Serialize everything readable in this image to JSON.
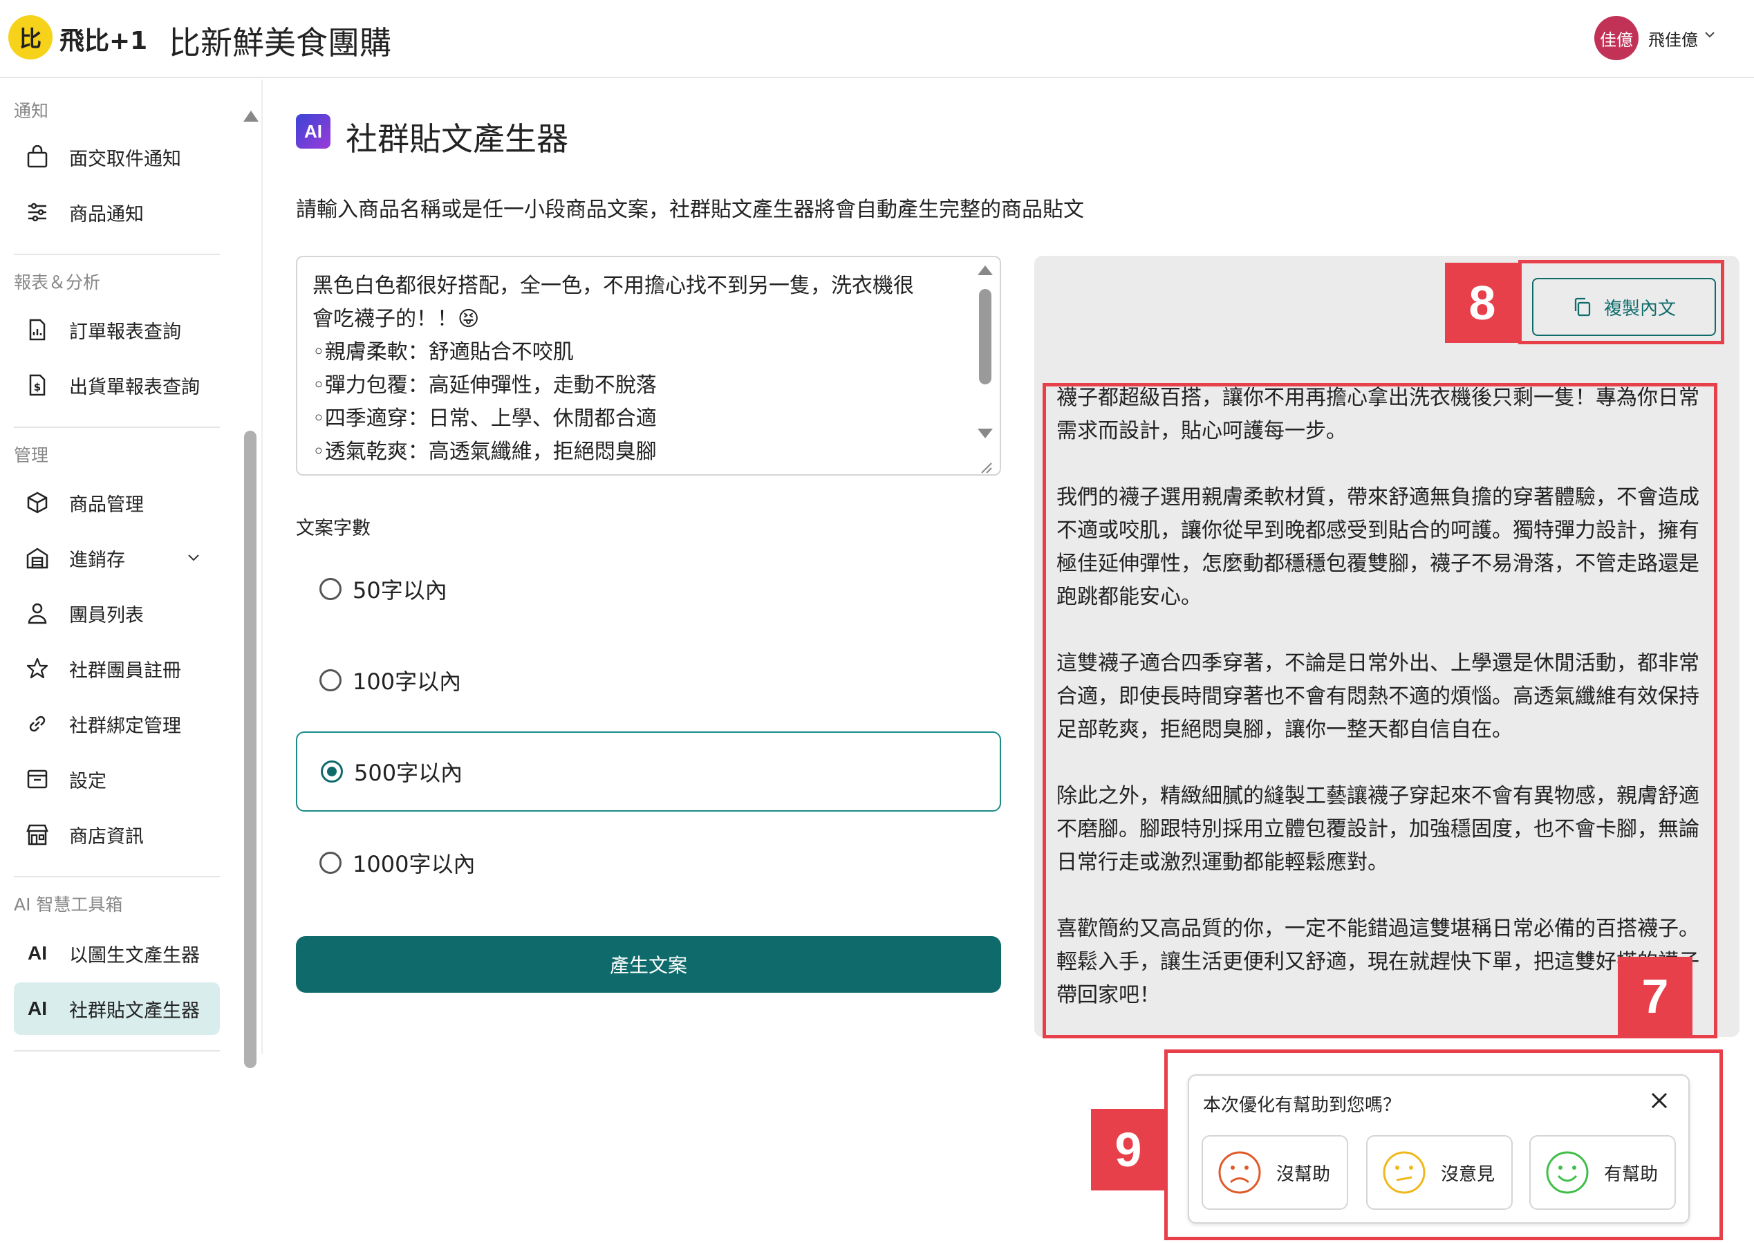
{
  "header": {
    "logo_mark": "比",
    "logo_text": "飛比+1",
    "store_name": "比新鮮美食團購",
    "avatar_text": "佳億",
    "user_name": "飛佳億"
  },
  "sidebar": {
    "sections": {
      "notify": "通知",
      "reports": "報表＆分析",
      "manage": "管理",
      "ai": "AI 智慧工具箱"
    },
    "items": {
      "pickup_notice": "面交取件通知",
      "product_notice": "商品通知",
      "order_report": "訂單報表查詢",
      "shipping_report": "出貨單報表查詢",
      "product_manage": "商品管理",
      "inventory": "進銷存",
      "member_list": "團員列表",
      "member_register": "社群團員註冊",
      "community_binding": "社群綁定管理",
      "settings": "設定",
      "store_info": "商店資訊",
      "image_copy_gen": "以圖生文產生器",
      "social_post_gen": "社群貼文產生器"
    },
    "ai_icon_text": "AI"
  },
  "main": {
    "ai_badge": "AI",
    "title": "社群貼文產生器",
    "description": "請輸入商品名稱或是任一小段商品文案，社群貼文產生器將會自動產生完整的商品貼文",
    "input_lines": [
      "黑色白色都很好搭配，全一色，不用擔心找不到另一隻，洗衣機很",
      "會吃襪子的！！😝",
      "◦親膚柔軟：舒適貼合不咬肌",
      "◦彈力包覆：高延伸彈性，走動不脫落",
      "◦四季適穿：日常、上學、休閒都合適",
      "◦透氣乾爽：高透氣纖維，拒絕悶臭腳"
    ],
    "count_label": "文案字數",
    "options": [
      "50字以內",
      "100字以內",
      "500字以內",
      "1000字以內"
    ],
    "selected_option": "500字以內",
    "generate_button": "產生文案"
  },
  "output": {
    "copy_button": "複製內文",
    "paragraphs": [
      "襪子都超級百搭，讓你不用再擔心拿出洗衣機後只剩一隻！專為你日常需求而設計，貼心呵護每一步。",
      "我們的襪子選用親膚柔軟材質，帶來舒適無負擔的穿著體驗，不會造成不適或咬肌，讓你從早到晚都感受到貼合的呵護。獨特彈力設計，擁有極佳延伸彈性，怎麼動都穩穩包覆雙腳，襪子不易滑落，不管走路還是跑跳都能安心。",
      "這雙襪子適合四季穿著，不論是日常外出、上學還是休閒活動，都非常合適，即使長時間穿著也不會有悶熱不適的煩惱。高透氣纖維有效保持足部乾爽，拒絕悶臭腳，讓你一整天都自信自在。",
      "除此之外，精緻細膩的縫製工藝讓襪子穿起來不會有異物感，親膚舒適不磨腳。腳跟特別採用立體包覆設計，加強穩固度，也不會卡腳，無論日常行走或激烈運動都能輕鬆應對。",
      "喜歡簡約又高品質的你，一定不能錯過這雙堪稱日常必備的百搭襪子。輕鬆入手，讓生活更便利又舒適，現在就趕快下單，把這雙好搭的襪子帶回家吧！"
    ]
  },
  "feedback": {
    "question": "本次優化有幫助到您嗎？",
    "options": [
      "沒幫助",
      "沒意見",
      "有幫助"
    ]
  },
  "annotations": [
    "8",
    "7",
    "9"
  ],
  "colors": {
    "primary": "#0f6b6b",
    "annotation": "#e8404a",
    "logo": "#f7d21a",
    "avatar": "#c23257"
  }
}
